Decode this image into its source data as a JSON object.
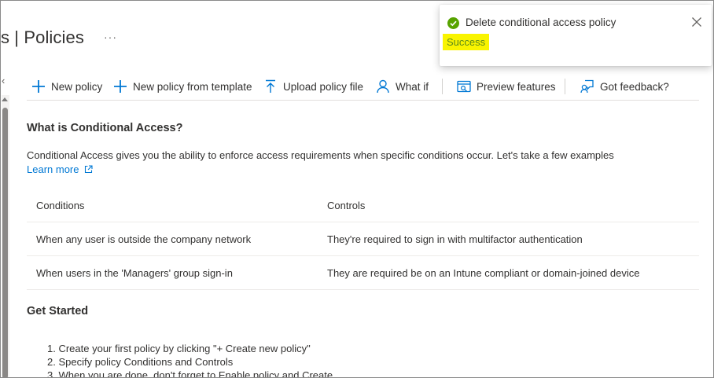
{
  "header": {
    "title": "s | Policies",
    "more": "···"
  },
  "toolbar": {
    "new_policy": "New policy",
    "new_from_template": "New policy from template",
    "upload_file": "Upload policy file",
    "what_if": "What if",
    "preview_features": "Preview features",
    "feedback": "Got feedback?"
  },
  "intro": {
    "heading": "What is Conditional Access?",
    "description": "Conditional Access gives you the ability to enforce access requirements when specific conditions occur. Let's take a few examples",
    "learn_more": "Learn more"
  },
  "examples": {
    "headers": [
      "Conditions",
      "Controls"
    ],
    "rows": [
      [
        "When any user is outside the company network",
        "They're required to sign in with multifactor authentication"
      ],
      [
        "When users in the 'Managers' group sign-in",
        "They are required be on an Intune compliant or domain-joined device"
      ]
    ]
  },
  "get_started": {
    "heading": "Get Started",
    "steps": [
      "1. Create your first policy by clicking \"+ Create new policy\"",
      "2. Specify policy Conditions and Controls",
      "3. When you are done, don't forget to Enable policy and Create"
    ]
  },
  "toast": {
    "title": "Delete conditional access policy",
    "status": "Success",
    "success_color": "#57a300",
    "highlight_color": "#f9f400"
  },
  "colors": {
    "accent": "#0078d4",
    "text": "#323130"
  }
}
